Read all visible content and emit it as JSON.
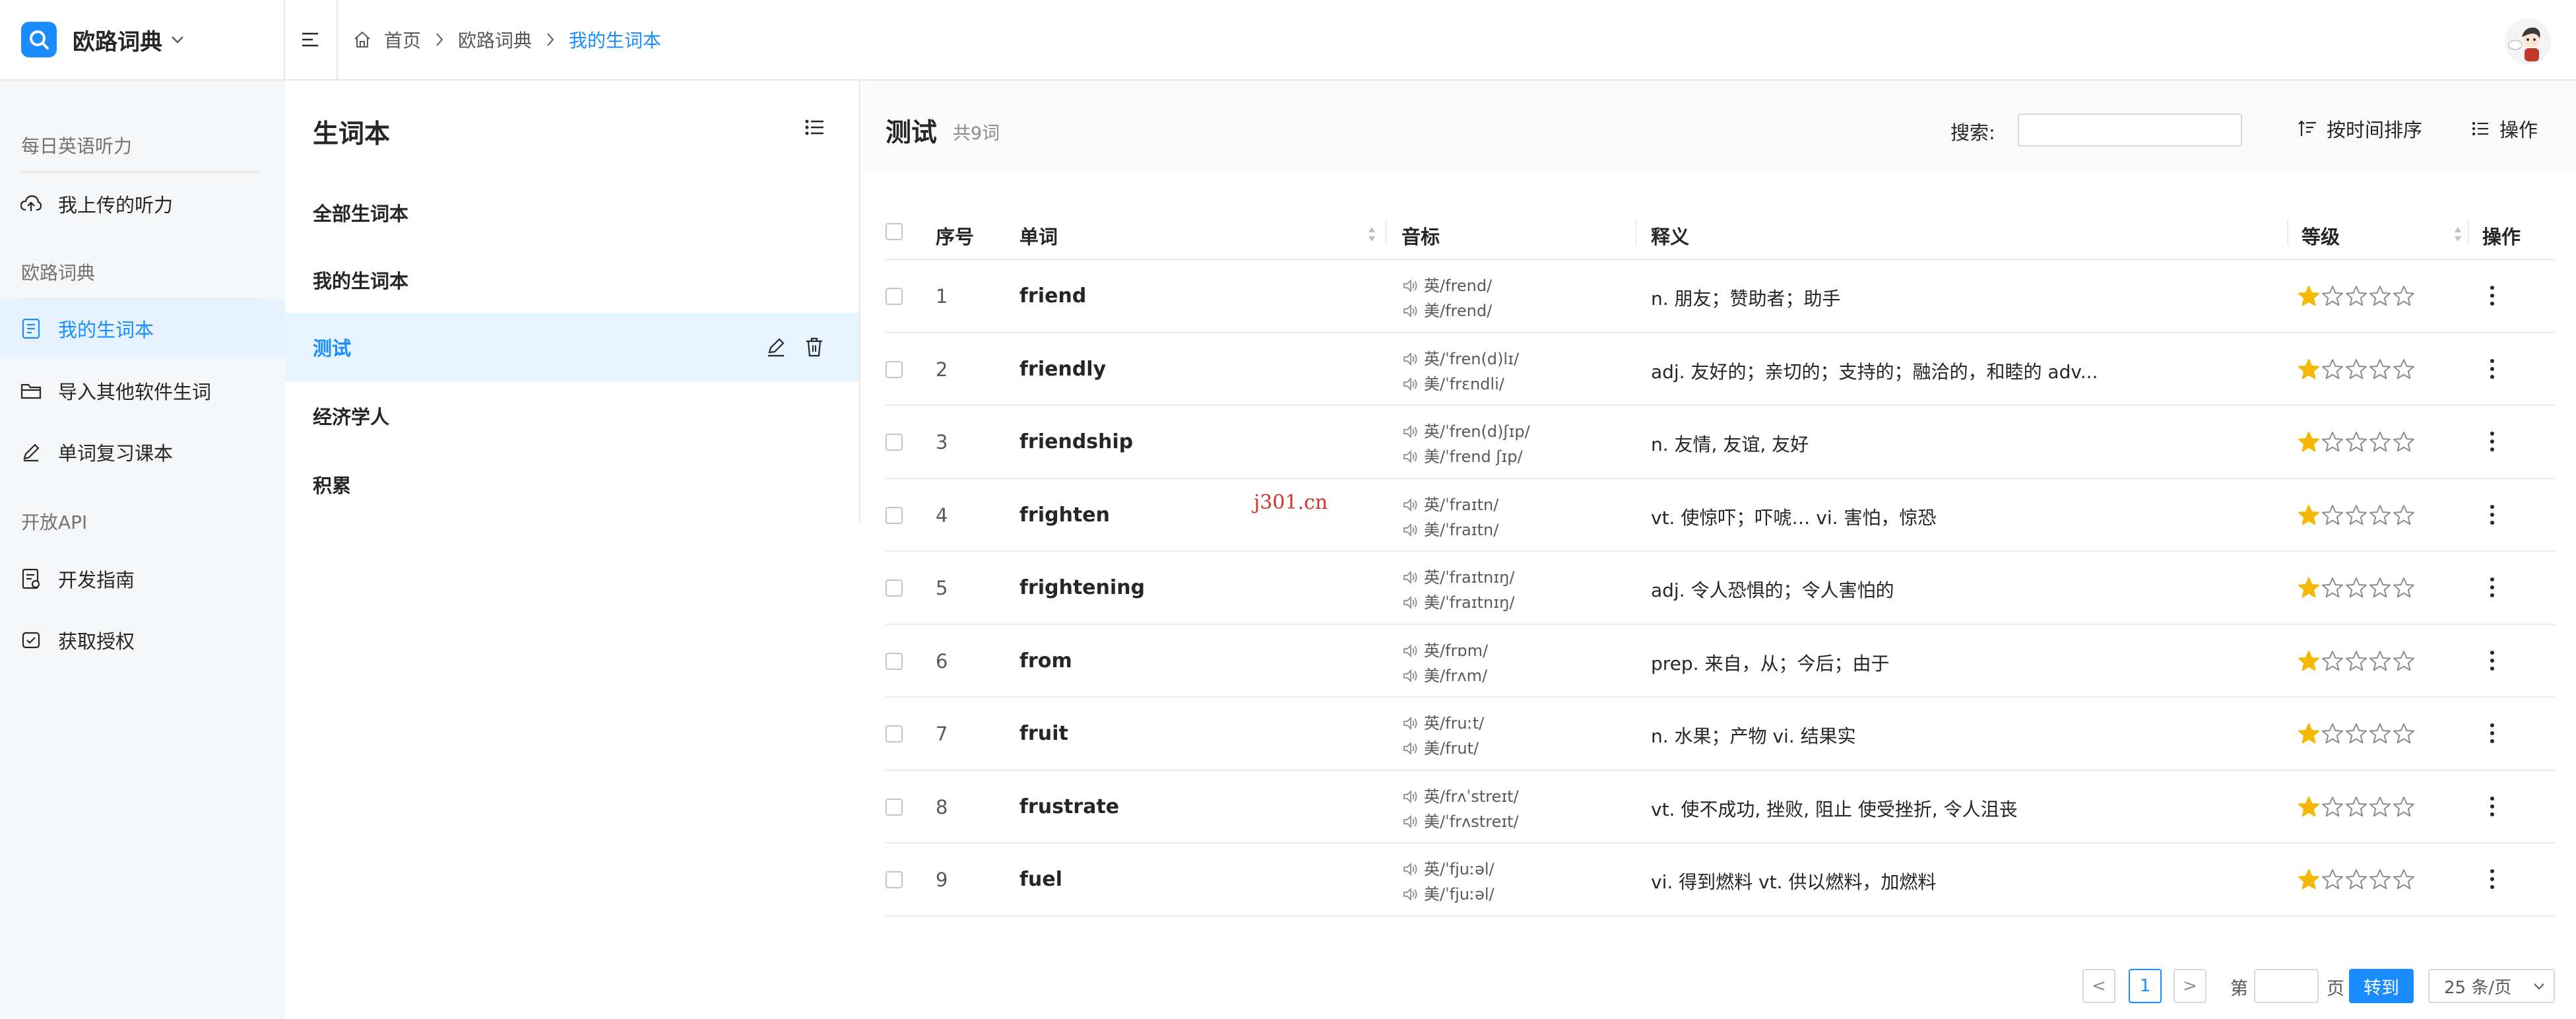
{
  "brand": {
    "name": "欧路词典"
  },
  "breadcrumb": {
    "home": "首页",
    "section": "欧路词典",
    "current": "我的生词本"
  },
  "sidebar": {
    "groups": [
      {
        "label": "每日英语听力",
        "items": [
          {
            "label": "我上传的听力",
            "icon": "cloud-upload-icon"
          }
        ]
      },
      {
        "label": "欧路词典",
        "items": [
          {
            "label": "我的生词本",
            "icon": "notebook-icon",
            "active": true
          },
          {
            "label": "导入其他软件生词",
            "icon": "folder-icon"
          },
          {
            "label": "单词复习课本",
            "icon": "pen-icon"
          }
        ]
      },
      {
        "label": "开放API",
        "items": [
          {
            "label": "开发指南",
            "icon": "doc-guide-icon"
          },
          {
            "label": "获取授权",
            "icon": "authorize-icon"
          }
        ]
      }
    ]
  },
  "notebooks": {
    "title": "生词本",
    "items": [
      "全部生词本",
      "我的生词本",
      "测试",
      "经济学人",
      "积累"
    ],
    "active_index": 2
  },
  "main": {
    "title": "测试",
    "count": "共9词",
    "search_label": "搜索:",
    "search_value": "",
    "sort_label": "按时间排序",
    "actions_label": "操作"
  },
  "table": {
    "headers": {
      "index": "序号",
      "word": "单词",
      "phonetic": "音标",
      "definition": "释义",
      "level": "等级",
      "action": "操作"
    },
    "rows": [
      {
        "index": "1",
        "word": "friend",
        "uk": "英/frend/",
        "us": "美/frend/",
        "definition": "n. 朋友；赞助者；助手",
        "stars": 1
      },
      {
        "index": "2",
        "word": "friendly",
        "uk": "英/ˈfren(d)lɪ/",
        "us": "美/ˈfrɛndli/",
        "definition": "adj. 友好的；亲切的；支持的；融洽的，和睦的 adv...",
        "stars": 1
      },
      {
        "index": "3",
        "word": "friendship",
        "uk": "英/ˈfren(d)ʃɪp/",
        "us": "美/ˈfrend ʃɪp/",
        "definition": "n. 友情, 友谊, 友好",
        "stars": 1
      },
      {
        "index": "4",
        "word": "frighten",
        "uk": "英/ˈfraɪtn/",
        "us": "美/ˈfraɪtn/",
        "definition": "vt. 使惊吓；吓唬… vi. 害怕，惊恐",
        "stars": 1
      },
      {
        "index": "5",
        "word": "frightening",
        "uk": "英/ˈfraɪtnɪŋ/",
        "us": "美/ˈfraɪtnɪŋ/",
        "definition": "adj. 令人恐惧的；令人害怕的",
        "stars": 1
      },
      {
        "index": "6",
        "word": "from",
        "uk": "英/frɒm/",
        "us": "美/frʌm/",
        "definition": "prep. 来自，从；今后；由于",
        "stars": 1
      },
      {
        "index": "7",
        "word": "fruit",
        "uk": "英/fruːt/",
        "us": "美/frut/",
        "definition": "n. 水果；产物 vi. 结果实",
        "stars": 1
      },
      {
        "index": "8",
        "word": "frustrate",
        "uk": "英/frʌˈstreɪt/",
        "us": "美/ˈfrʌstreɪt/",
        "definition": "vt. 使不成功, 挫败, 阻止 使受挫折, 令人沮丧",
        "stars": 1
      },
      {
        "index": "9",
        "word": "fuel",
        "uk": "英/ˈfjuːəl/",
        "us": "美/ˈfjuːəl/",
        "definition": "vi. 得到燃料 vt. 供以燃料，加燃料",
        "stars": 1
      }
    ],
    "max_stars": 5
  },
  "pagination": {
    "prev": "<",
    "current_page": "1",
    "next": ">",
    "goto_prefix": "第",
    "goto_suffix": "页",
    "goto_value": "",
    "goto_button": "转到",
    "page_size": "25 条/页"
  },
  "watermark": "j301.cn",
  "colors": {
    "accent": "#1a8cff",
    "star": "#f5b800",
    "sidebar_bg": "#f5f6f8",
    "active_bg": "#e6f3ff"
  }
}
